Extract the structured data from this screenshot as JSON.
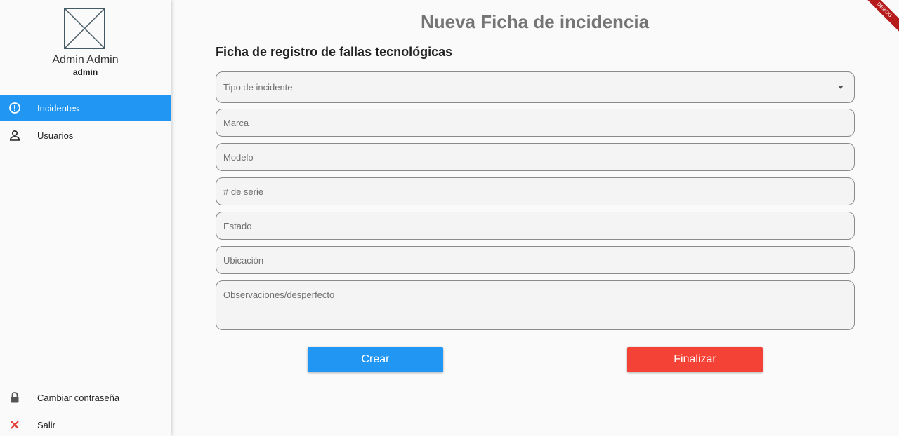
{
  "user": {
    "name": "Admin Admin",
    "login": "admin",
    "avatar_icon": "image-placeholder-icon"
  },
  "sidebar": {
    "items": [
      {
        "label": "Incidentes",
        "icon": "alert-circle-icon",
        "active": true
      },
      {
        "label": "Usuarios",
        "icon": "person-icon",
        "active": false
      }
    ],
    "bottom": [
      {
        "label": "Cambiar contraseña",
        "icon": "lock-icon"
      },
      {
        "label": "Salir",
        "icon": "close-icon"
      }
    ]
  },
  "page": {
    "title": "Nueva Ficha de incidencia",
    "form_title": "Ficha de registro de fallas tecnológicas"
  },
  "form": {
    "tipo": {
      "placeholder": "Tipo de incidente"
    },
    "marca": {
      "placeholder": "Marca"
    },
    "modelo": {
      "placeholder": "Modelo"
    },
    "serie": {
      "placeholder": "# de serie"
    },
    "estado": {
      "placeholder": "Estado"
    },
    "ubicacion": {
      "placeholder": "Ubicación"
    },
    "observaciones": {
      "placeholder": "Observaciones/desperfecto"
    }
  },
  "actions": {
    "create": "Crear",
    "finish": "Finalizar"
  },
  "banner": {
    "debug": "DEBUG"
  },
  "colors": {
    "primary": "#2196f3",
    "danger": "#f44336"
  }
}
